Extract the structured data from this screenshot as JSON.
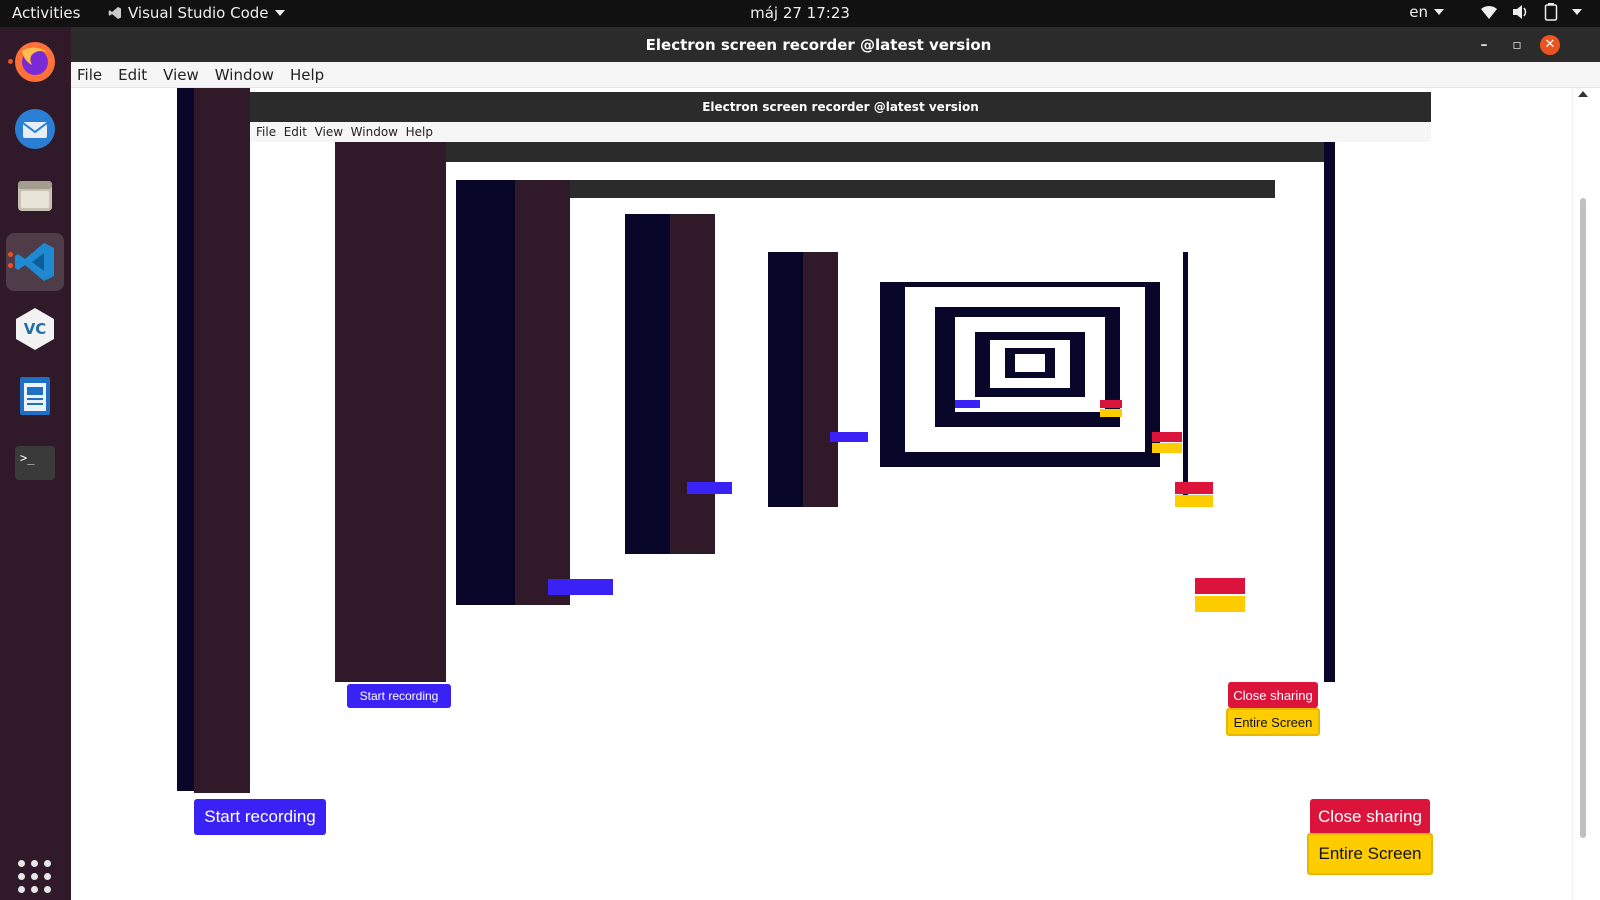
{
  "topbar": {
    "activities": "Activities",
    "app_name": "Visual Studio Code",
    "clock": "máj 27  17:23",
    "language": "en"
  },
  "dock": {
    "items": [
      {
        "name": "firefox-icon",
        "color": "#ff7139"
      },
      {
        "name": "thunderbird-icon",
        "color": "#2a7fd4"
      },
      {
        "name": "files-icon",
        "color": "#c8c2b4"
      },
      {
        "name": "vscode-icon",
        "color": "#1f8ad2"
      },
      {
        "name": "veracrypt-icon",
        "color": "#f2f2f2"
      },
      {
        "name": "writer-icon",
        "color": "#1e6fc5"
      },
      {
        "name": "terminal-icon",
        "color": "#3a3a3a"
      }
    ]
  },
  "window": {
    "title": "Electron screen recorder @latest version",
    "menu": [
      "File",
      "Edit",
      "View",
      "Window",
      "Help"
    ]
  },
  "buttons": {
    "start_recording": "Start recording",
    "close_sharing": "Close sharing",
    "entire_screen": "Entire Screen"
  },
  "colors": {
    "accent_start": "#3a21f5",
    "accent_close": "#dc143c",
    "accent_entire": "#ffcc00",
    "dock_bg": "#301a2a"
  }
}
